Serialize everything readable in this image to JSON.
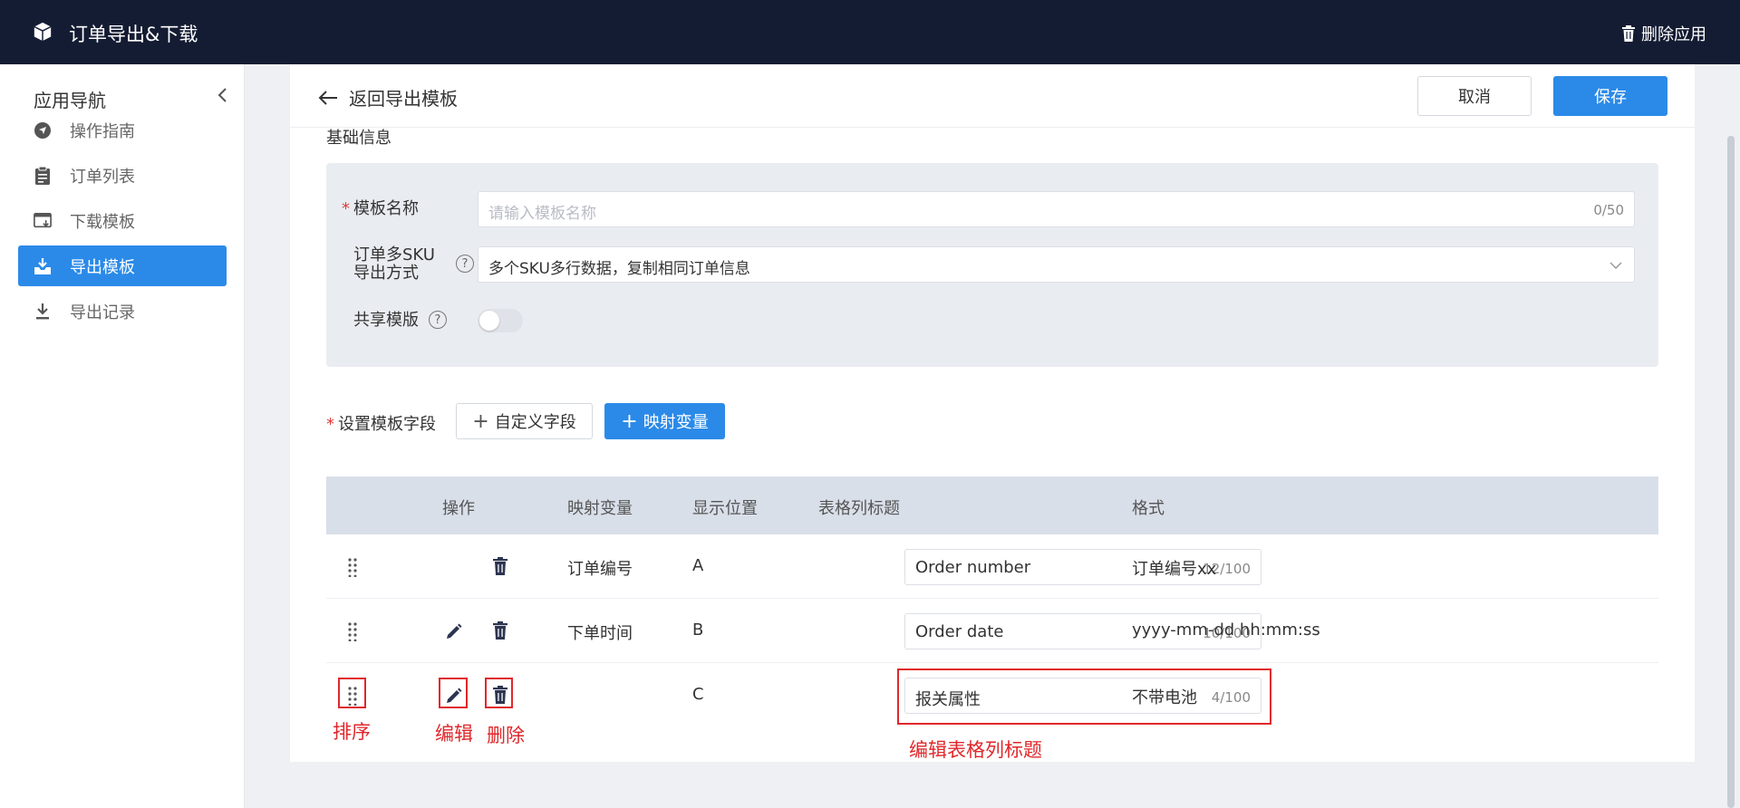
{
  "topbar": {
    "title": "订单导出&下载",
    "delete_label": "删除应用"
  },
  "sidebar": {
    "title": "应用导航",
    "items": [
      {
        "label": "操作指南",
        "icon": "navigation-icon"
      },
      {
        "label": "订单列表",
        "icon": "clipboard-icon"
      },
      {
        "label": "下载模板",
        "icon": "template-download-icon"
      },
      {
        "label": "导出模板",
        "icon": "export-tray-icon",
        "active": true
      },
      {
        "label": "导出记录",
        "icon": "download-icon"
      }
    ]
  },
  "header": {
    "back_label": "返回导出模板",
    "cancel_label": "取消",
    "save_label": "保存"
  },
  "basic": {
    "section_title": "基础信息",
    "name_label": "模板名称",
    "name_placeholder": "请输入模板名称",
    "name_count": "0/50",
    "sku_label_line1": "订单多SKU",
    "sku_label_line2": "导出方式",
    "sku_value": "多个SKU多行数据，复制相同订单信息",
    "share_label": "共享模版",
    "help_glyph": "?",
    "share_on": false
  },
  "fields": {
    "label": "设置模板字段",
    "custom_button": "自定义字段",
    "map_button": "映射变量",
    "plus": "+"
  },
  "table": {
    "headers": [
      "操作",
      "映射变量",
      "显示位置",
      "表格列标题",
      "格式"
    ],
    "rows": [
      {
        "variable": "订单编号",
        "position": "A",
        "title": "Order number",
        "count": "12/100",
        "format": "订单编号xx",
        "editable": false
      },
      {
        "variable": "下单时间",
        "position": "B",
        "title": "Order date",
        "count": "10/100",
        "format": "yyyy-mm-dd hh:mm:ss",
        "editable": true
      },
      {
        "variable": "",
        "position": "C",
        "title": "报关属性",
        "count": "4/100",
        "format": "不带电池",
        "editable": true
      }
    ]
  },
  "annotations": {
    "sort": "排序",
    "edit": "编辑",
    "delete": "删除",
    "edit_title": "编辑表格列标题",
    "color": "#e0272b"
  },
  "colors": {
    "topbar": "#141c33",
    "accent": "#2b8ae8"
  }
}
